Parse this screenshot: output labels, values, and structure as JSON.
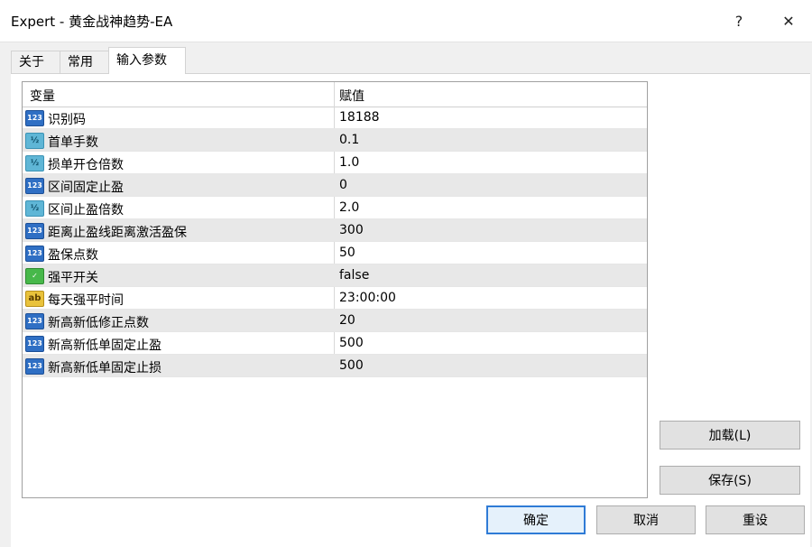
{
  "window": {
    "title": "Expert - 黄金战神趋势-EA",
    "help_label": "?",
    "close_label": "✕"
  },
  "tabs": [
    {
      "label": "关于"
    },
    {
      "label": "常用"
    },
    {
      "label": "输入参数"
    }
  ],
  "grid": {
    "headers": {
      "variable": "变量",
      "value": "赋值"
    },
    "rows": [
      {
        "type": "int",
        "icon_text": "123",
        "name": "识别码",
        "value": "18188"
      },
      {
        "type": "double",
        "icon_text": "½",
        "name": "首单手数",
        "value": "0.1"
      },
      {
        "type": "double",
        "icon_text": "½",
        "name": "损单开仓倍数",
        "value": "1.0"
      },
      {
        "type": "int",
        "icon_text": "123",
        "name": "区间固定止盈",
        "value": "0"
      },
      {
        "type": "double",
        "icon_text": "½",
        "name": "区间止盈倍数",
        "value": "2.0"
      },
      {
        "type": "int",
        "icon_text": "123",
        "name": "距离止盈线距离激活盈保",
        "value": "300"
      },
      {
        "type": "int",
        "icon_text": "123",
        "name": "盈保点数",
        "value": "50"
      },
      {
        "type": "bool",
        "icon_text": "✓",
        "name": "强平开关",
        "value": "false"
      },
      {
        "type": "string",
        "icon_text": "ab",
        "name": "每天强平时间",
        "value": "23:00:00"
      },
      {
        "type": "int",
        "icon_text": "123",
        "name": "新高新低修正点数",
        "value": "20"
      },
      {
        "type": "int",
        "icon_text": "123",
        "name": "新高新低单固定止盈",
        "value": "500"
      },
      {
        "type": "int",
        "icon_text": "123",
        "name": "新高新低单固定止损",
        "value": "500"
      }
    ]
  },
  "buttons": {
    "load": "加载(L)",
    "save": "保存(S)",
    "ok": "确定",
    "cancel": "取消",
    "reset": "重设"
  },
  "colors": {
    "default_button_border": "#2f7bd6",
    "alt_row": "#e8e8e8",
    "int_icon": "#2f6fc4",
    "double_icon": "#5fb6d6",
    "bool_icon": "#47b84a",
    "string_icon": "#e9c23b"
  }
}
